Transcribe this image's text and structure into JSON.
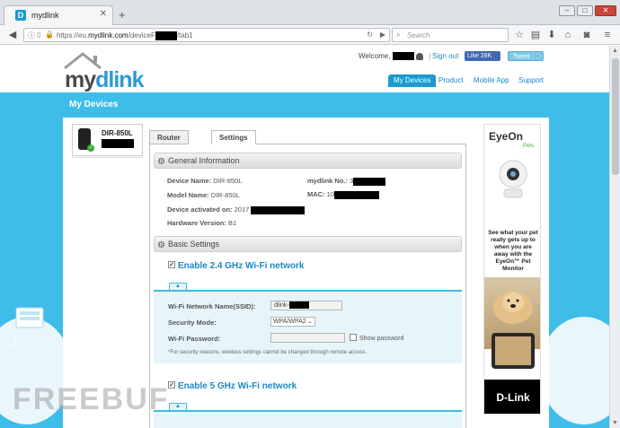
{
  "browser": {
    "tab_title": "mydlink",
    "favicon_letter": "D",
    "url_prefix": "https://eu.",
    "url_domain": "mydlink.com",
    "url_path_a": "/deviceF",
    "url_path_b": "/tab1",
    "search_placeholder": "Search"
  },
  "header": {
    "logo_my": "my",
    "logo_dlink": "dlink",
    "welcome_label": "Welcome,",
    "divider": "|",
    "signout_label": "Sign out",
    "fb_like_label": "Like 28K",
    "tweet_label": "Tweet",
    "nav": [
      {
        "label": "My Devices",
        "active": true
      },
      {
        "label": "Product",
        "active": false
      },
      {
        "label": "Mobile App",
        "active": false
      },
      {
        "label": "Support",
        "active": false
      }
    ]
  },
  "section_title": "My Devices",
  "device": {
    "name": "DIR-850L",
    "status_color": "#3aaa35"
  },
  "tabs": [
    {
      "label": "Router Status",
      "active": false
    },
    {
      "label": "Settings",
      "active": true
    }
  ],
  "general": {
    "title": "General Information",
    "device_name_label": "Device Name:",
    "device_name_value": "DIR-850L",
    "model_name_label": "Model Name:",
    "model_name_value": "DIR-850L",
    "activated_label": "Device activated on:",
    "activated_value": "2017",
    "hw_label": "Hardware Version:",
    "hw_value": "B1",
    "mydlink_no_label": "mydlink No.:",
    "mydlink_no_value": "3",
    "mac_label": "MAC:",
    "mac_value": "10"
  },
  "basic": {
    "title": "Basic Settings",
    "wifi24_label": "Enable 2.4 GHz Wi-Fi network",
    "wifi5_label": "Enable 5 GHz Wi-Fi network",
    "ssid_label": "Wi-Fi Network Name(SSID):",
    "ssid_value": "dlink-",
    "security_label": "Security Mode:",
    "security_value": "WPA/WPA2",
    "password_label": "Wi-Fi Password:",
    "show_password_label": "Show password",
    "note": "*For security reasons, wireless settings cannot be changed through remote access."
  },
  "ad": {
    "brand_top": "EyeOn",
    "brand_sub": "Pets",
    "text": "See what your pet really gets up to when you are away with the EyeOn™ Pet Monitor",
    "brand_bottom": "D-Link"
  },
  "watermark": "FREEBUF",
  "colors": {
    "accent": "#3dbde8",
    "link": "#1a88c5"
  }
}
